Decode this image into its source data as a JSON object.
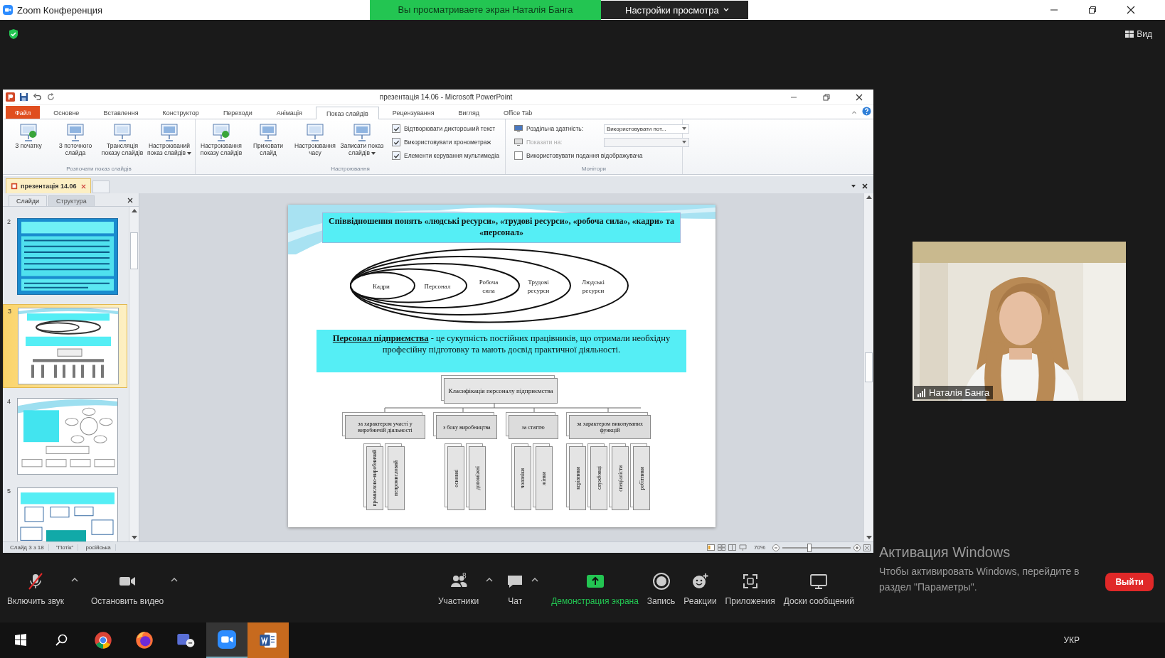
{
  "zoom_window": {
    "title": "Zoom Конференция",
    "share_banner": "Вы просматриваете экран Наталія Банга",
    "view_options": "Настройки просмотра",
    "view_button": "Вид"
  },
  "powerpoint": {
    "title": "презентація 14.06 - Microsoft PowerPoint",
    "tabs": [
      {
        "label": "Файл",
        "kind": "file",
        "selected": false
      },
      {
        "label": "Основне",
        "kind": "tab",
        "selected": false
      },
      {
        "label": "Вставлення",
        "kind": "tab",
        "selected": false
      },
      {
        "label": "Конструктор",
        "kind": "tab",
        "selected": false
      },
      {
        "label": "Переходи",
        "kind": "tab",
        "selected": false
      },
      {
        "label": "Анімація",
        "kind": "tab",
        "selected": false
      },
      {
        "label": "Показ слайдів",
        "kind": "tab",
        "selected": true
      },
      {
        "label": "Рецензування",
        "kind": "tab",
        "selected": false
      },
      {
        "label": "Вигляд",
        "kind": "tab",
        "selected": false
      },
      {
        "label": "Office Tab",
        "kind": "tab",
        "selected": false
      }
    ],
    "ribbon_groups": [
      {
        "label": "Розпочати показ слайдів",
        "buttons": [
          {
            "label": "З початку",
            "menu": false
          },
          {
            "label": "З поточного слайда",
            "menu": false
          },
          {
            "label": "Трансляція показу слайдів",
            "menu": false
          },
          {
            "label": "Настроюваний показ слайдів",
            "menu": true
          }
        ]
      },
      {
        "label": "Настроювання",
        "buttons": [
          {
            "label": "Настроювання показу слайдів",
            "menu": false
          },
          {
            "label": "Приховати слайд",
            "menu": false
          },
          {
            "label": "Настроювання часу",
            "menu": false
          },
          {
            "label": "Записати показ слайдів",
            "menu": true
          }
        ],
        "options": [
          {
            "kind": "checkbox",
            "label": "Відтворювати дикторський текст",
            "checked": true
          },
          {
            "kind": "checkbox",
            "label": "Використовувати хронометраж",
            "checked": true
          },
          {
            "kind": "checkbox",
            "label": "Елементи керування мультимедіа",
            "checked": true
          }
        ]
      },
      {
        "label": "Монітори",
        "options": [
          {
            "kind": "dropdown",
            "label": "Роздільна здатність:",
            "value": "Використовувати пот...",
            "disabled": false
          },
          {
            "kind": "dropdown",
            "label": "Показати на:",
            "disabled": true
          },
          {
            "kind": "checkbox",
            "label": "Використовувати подання відображувача",
            "checked": false
          }
        ]
      }
    ],
    "doc_tab": "презентація 14.06",
    "pane_tabs": [
      {
        "label": "Слайди",
        "selected": true
      },
      {
        "label": "Структура",
        "selected": false
      }
    ],
    "thumbnails": [
      {
        "number": "2",
        "kind": "text",
        "selected": false
      },
      {
        "number": "3",
        "kind": "ellipses",
        "selected": true
      },
      {
        "number": "4",
        "kind": "cycle",
        "selected": false
      },
      {
        "number": "5",
        "kind": "flow",
        "selected": false
      }
    ],
    "slide": {
      "title": "Співвідношення понять «людські ресурси», «трудові ресурси», «робоча сила», «кадри» та «персонал»",
      "ellipses": [
        "Кадри",
        "Персонал",
        "Робоча сила",
        "Трудові ресурси",
        "Людські ресурси"
      ],
      "definition": "**Персонал підприємства** - це сукупність постійних працівників, що отримали необхідну професійну підготовку та мають досвід практичної діяльності.",
      "chart_root": "Класифікація персоналу підприємства",
      "categories": [
        {
          "label": "за характером участі у виробничій діяльності",
          "children": [
            "промислово-виробничий",
            "непромисловий"
          ]
        },
        {
          "label": "з боку виробництва",
          "children": [
            "основні",
            "допоміжні"
          ]
        },
        {
          "label": "за статтю",
          "children": [
            "чоловіки",
            "жінки"
          ]
        },
        {
          "label": "за характером виконуваних функцій",
          "children": [
            "керівники",
            "службовці",
            "спеціалісти",
            "робітники"
          ]
        }
      ]
    },
    "status_bar": {
      "slide": "Слайд 3 з 18",
      "theme": "\"Потік\"",
      "language": "російська",
      "zoom": "70%",
      "zoom_slider": {
        "level": 0.4
      }
    }
  },
  "video": {
    "name": "Наталія Банга"
  },
  "zoom_toolbar": [
    {
      "kind": "mic",
      "label": "Включить звук",
      "muted": true,
      "menu": true
    },
    {
      "kind": "video",
      "label": "Остановить видео",
      "menu": true
    },
    {
      "kind": "participants",
      "label": "Участники",
      "count": "8",
      "menu": true
    },
    {
      "kind": "chat",
      "label": "Чат",
      "menu": true
    },
    {
      "kind": "share",
      "label": "Демонстрация экрана",
      "menu": false
    },
    {
      "kind": "record",
      "label": "Запись",
      "menu": false
    },
    {
      "kind": "reactions",
      "label": "Реакции",
      "menu": false
    },
    {
      "kind": "apps",
      "label": "Приложения",
      "menu": false
    },
    {
      "kind": "whiteboards",
      "label": "Доски сообщений",
      "menu": false
    }
  ],
  "leave_button": "Выйти",
  "activation": {
    "title": "Активация Windows",
    "text": "Чтобы активировать Windows, перейдите в раздел \"Параметры\"."
  },
  "taskbar": {
    "apps": [
      {
        "kind": "start",
        "selected": false,
        "highlighted": false
      },
      {
        "kind": "search",
        "selected": false,
        "highlighted": false
      },
      {
        "kind": "chrome",
        "selected": false,
        "highlighted": false
      },
      {
        "kind": "firefox",
        "selected": false,
        "highlighted": false
      },
      {
        "kind": "teams",
        "selected": false,
        "highlighted": false
      },
      {
        "kind": "zoom",
        "selected": true,
        "highlighted": false
      },
      {
        "kind": "word",
        "selected": false,
        "highlighted": true
      }
    ],
    "language": "УКР"
  }
}
